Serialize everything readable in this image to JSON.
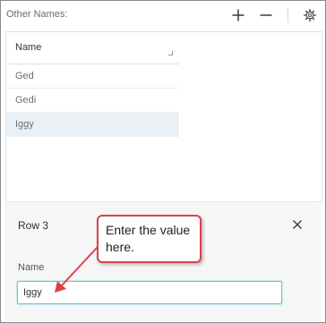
{
  "header": {
    "title": "Other Names:",
    "icons": [
      "plus-icon",
      "minus-icon",
      "gear-icon"
    ]
  },
  "table": {
    "columns": [
      "Name"
    ],
    "rows": [
      {
        "name": "Ged",
        "selected": false
      },
      {
        "name": "Gedi",
        "selected": false
      },
      {
        "name": "Iggy",
        "selected": true
      }
    ]
  },
  "detail": {
    "title": "Row 3",
    "field_label": "Name",
    "field_value": "Iggy"
  },
  "callout": {
    "text": "Enter the value here."
  },
  "colors": {
    "selected_row": "#e9f1f6",
    "callout_border": "#d8434a",
    "input_focus": "#7fbfd0"
  }
}
